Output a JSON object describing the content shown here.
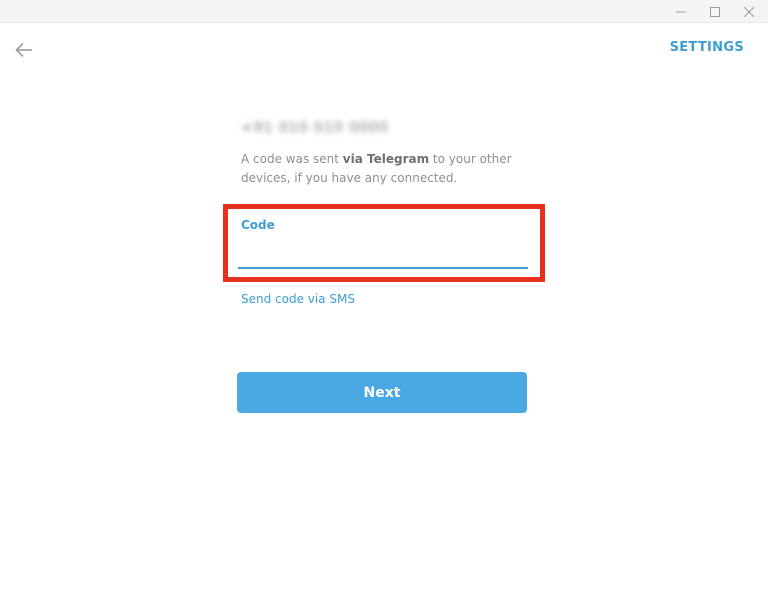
{
  "window_controls": {
    "minimize_icon": "minimize-icon",
    "maximize_icon": "maximize-icon",
    "close_icon": "close-icon"
  },
  "header": {
    "back_icon": "arrow-left-icon",
    "settings_label": "SETTINGS"
  },
  "login": {
    "phone_number": "+91 010 010 0000",
    "description_prefix": "A code was sent ",
    "description_bold": "via Telegram",
    "description_suffix": " to your other devices, if you have any connected.",
    "code_label": "Code",
    "code_value": "",
    "send_sms_label": "Send code via SMS",
    "next_label": "Next"
  },
  "colors": {
    "accent": "#3e9ed4",
    "button": "#4aa8e3",
    "highlight_border": "#e8301c"
  }
}
